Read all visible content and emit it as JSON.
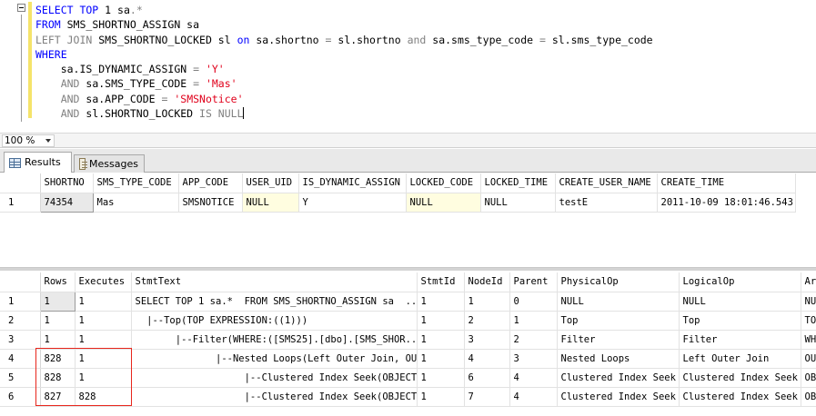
{
  "editor": {
    "lines": [
      [
        {
          "t": "SELECT TOP ",
          "c": "kw"
        },
        {
          "t": "1 sa",
          "c": "txt"
        },
        {
          "t": ".",
          "c": "gray"
        },
        {
          "t": "*",
          "c": "gray"
        }
      ],
      [
        {
          "t": "FROM ",
          "c": "kw"
        },
        {
          "t": "SMS_SHORTNO_ASSIGN sa",
          "c": "txt"
        }
      ],
      [
        {
          "t": "LEFT JOIN ",
          "c": "gray"
        },
        {
          "t": "SMS_SHORTNO_LOCKED sl ",
          "c": "txt"
        },
        {
          "t": "on ",
          "c": "kw"
        },
        {
          "t": "sa.shortno ",
          "c": "txt"
        },
        {
          "t": "= ",
          "c": "gray"
        },
        {
          "t": "sl.shortno ",
          "c": "txt"
        },
        {
          "t": "and ",
          "c": "gray"
        },
        {
          "t": "sa.sms_type_code ",
          "c": "txt"
        },
        {
          "t": "= ",
          "c": "gray"
        },
        {
          "t": "sl.sms_type_code",
          "c": "txt"
        }
      ],
      [
        {
          "t": "WHERE",
          "c": "kw"
        }
      ],
      [
        {
          "t": "    sa.IS_DYNAMIC_ASSIGN ",
          "c": "txt"
        },
        {
          "t": "= ",
          "c": "gray"
        },
        {
          "t": "'Y'",
          "c": "str"
        }
      ],
      [
        {
          "t": "    AND ",
          "c": "gray"
        },
        {
          "t": "sa.SMS_TYPE_CODE ",
          "c": "txt"
        },
        {
          "t": "= ",
          "c": "gray"
        },
        {
          "t": "'Mas'",
          "c": "str"
        }
      ],
      [
        {
          "t": "    AND ",
          "c": "gray"
        },
        {
          "t": "sa.APP_CODE ",
          "c": "txt"
        },
        {
          "t": "= ",
          "c": "gray"
        },
        {
          "t": "'SMSNotice'",
          "c": "str"
        }
      ],
      [
        {
          "t": "    AND ",
          "c": "gray"
        },
        {
          "t": "sl.SHORTNO_LOCKED ",
          "c": "txt"
        },
        {
          "t": "IS NULL",
          "c": "gray"
        }
      ]
    ]
  },
  "zoom": {
    "value": "100 %"
  },
  "tabs": {
    "results": "Results",
    "messages": "Messages"
  },
  "results": {
    "columns": [
      "SHORTNO",
      "SMS_TYPE_CODE",
      "APP_CODE",
      "USER_UID",
      "IS_DYNAMIC_ASSIGN",
      "LOCKED_CODE",
      "LOCKED_TIME",
      "CREATE_USER_NAME",
      "CREATE_TIME"
    ],
    "rows": [
      {
        "n": "1",
        "cells": [
          "74354",
          "Mas",
          "SMSNOTICE",
          "NULL",
          "Y",
          "NULL",
          "NULL",
          "testE",
          "2011-10-09 18:01:46.543"
        ]
      }
    ]
  },
  "plan": {
    "columns": [
      "Rows",
      "Executes",
      "StmtText",
      "StmtId",
      "NodeId",
      "Parent",
      "PhysicalOp",
      "LogicalOp",
      "Ar"
    ],
    "rows": [
      {
        "n": "1",
        "cells": [
          "1",
          "1",
          "SELECT TOP 1 sa.*  FROM SMS_SHORTNO_ASSIGN sa  ...",
          "1",
          "1",
          "0",
          "NULL",
          "NULL",
          "NU"
        ]
      },
      {
        "n": "2",
        "cells": [
          "1",
          "1",
          "  |--Top(TOP EXPRESSION:((1)))",
          "1",
          "2",
          "1",
          "Top",
          "Top",
          "TO"
        ]
      },
      {
        "n": "3",
        "cells": [
          "1",
          "1",
          "       |--Filter(WHERE:([SMS25].[dbo].[SMS_SHOR...",
          "1",
          "3",
          "2",
          "Filter",
          "Filter",
          "WH"
        ]
      },
      {
        "n": "4",
        "cells": [
          "828",
          "1",
          "              |--Nested Loops(Left Outer Join, OU...",
          "1",
          "4",
          "3",
          "Nested Loops",
          "Left Outer Join",
          "OU"
        ]
      },
      {
        "n": "5",
        "cells": [
          "828",
          "1",
          "                   |--Clustered Index Seek(OBJECT...",
          "1",
          "6",
          "4",
          "Clustered Index Seek",
          "Clustered Index Seek",
          "OB"
        ]
      },
      {
        "n": "6",
        "cells": [
          "827",
          "828",
          "                   |--Clustered Index Seek(OBJECT...",
          "1",
          "7",
          "4",
          "Clustered Index Seek",
          "Clustered Index Seek",
          "OB"
        ]
      }
    ]
  },
  "colors": {
    "keyword": "#0000ff",
    "operator": "#808080",
    "string": "#e0001b",
    "highlight_box": "#e8261c"
  }
}
